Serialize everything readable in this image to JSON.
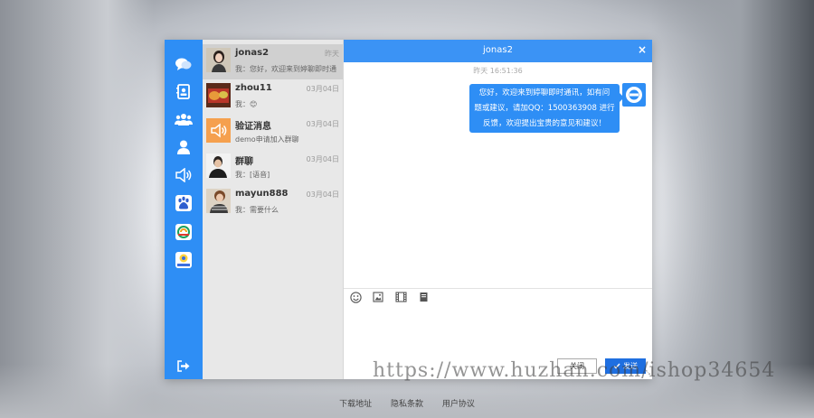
{
  "chat": {
    "title": "jonas2",
    "close_glyph": "×",
    "timestamp": "昨天 16:51:36",
    "message_lines": [
      "您好，欢迎来到婷聊即时通讯，如有问",
      "题或建议，请加QQ：1500363908 进行",
      "反馈，欢迎提出宝贵的意见和建议！"
    ],
    "close_button": "关闭",
    "send_button": "发送",
    "send_icon": "check-icon"
  },
  "conversations": [
    {
      "name": "jonas2",
      "time": "昨天",
      "preview": "我：您好，欢迎来到婷聊即时通",
      "active": true
    },
    {
      "name": "zhou11",
      "time": "03月04日",
      "preview": "我：😊",
      "active": false
    },
    {
      "name": "验证消息",
      "time": "03月04日",
      "preview": "demo申请加入群聊",
      "active": false
    },
    {
      "name": "群聊",
      "time": "03月04日",
      "preview": "我：[语音]",
      "active": false
    },
    {
      "name": "mayun888",
      "time": "03月04日",
      "preview": "我：需要什么",
      "active": false
    }
  ],
  "rail": [
    "chat-icon",
    "contacts-icon",
    "group-icon",
    "user-icon",
    "speaker-icon",
    "baidu-icon",
    "tencent-video-icon",
    "map-app-icon",
    "logout-icon"
  ],
  "footer": {
    "download": "下载地址",
    "privacy": "隐私条款",
    "agreement": "用户协议"
  },
  "watermark": "https://www.huzhan.com/ishop34654",
  "colors": {
    "accent": "#2e8ef5",
    "header": "#3b93f5",
    "send": "#1f6fe0"
  }
}
